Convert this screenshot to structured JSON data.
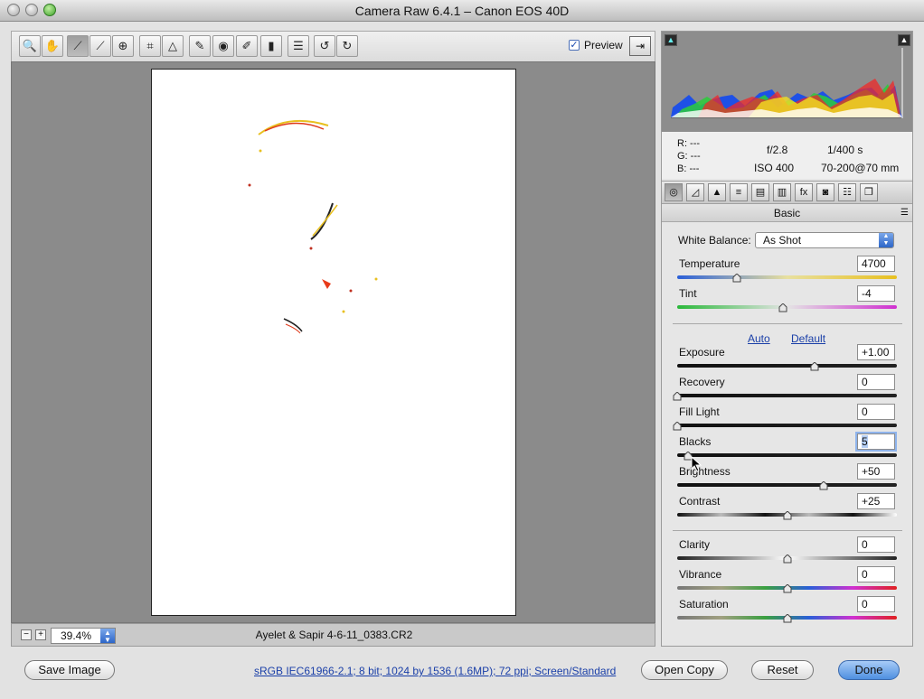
{
  "window": {
    "title": "Camera Raw 6.4.1  –  Canon EOS 40D"
  },
  "toolbar": {
    "tools": [
      {
        "name": "zoom-tool",
        "glyph": "🔍"
      },
      {
        "name": "hand-tool",
        "glyph": "✋"
      },
      {
        "name": "white-balance-tool",
        "glyph": "⟋"
      },
      {
        "name": "color-sampler-tool",
        "glyph": "⟋"
      },
      {
        "name": "targeted-adjustment-tool",
        "glyph": "⊕"
      },
      {
        "name": "crop-tool",
        "glyph": "⌗"
      },
      {
        "name": "straighten-tool",
        "glyph": "△"
      },
      {
        "name": "spot-removal-tool",
        "glyph": "✎"
      },
      {
        "name": "red-eye-tool",
        "glyph": "◉"
      },
      {
        "name": "adjustment-brush-tool",
        "glyph": "✐"
      },
      {
        "name": "graduated-filter-tool",
        "glyph": "▮"
      },
      {
        "name": "preferences-tool",
        "glyph": "☰"
      },
      {
        "name": "rotate-left-tool",
        "glyph": "↺"
      },
      {
        "name": "rotate-right-tool",
        "glyph": "↻"
      }
    ],
    "preview_label": "Preview",
    "preview_checked": true
  },
  "status": {
    "zoom": "39.4%",
    "filename": "Ayelet & Sapir 4-6-11_0383.CR2"
  },
  "info": {
    "r": "R:  ---",
    "g": "G:  ---",
    "b": "B:  ---",
    "aperture": "f/2.8",
    "shutter": "1/400 s",
    "iso": "ISO 400",
    "lens": "70-200@70 mm"
  },
  "panel": {
    "title": "Basic",
    "tabs": [
      {
        "name": "basic",
        "glyph": "◎"
      },
      {
        "name": "tone-curve",
        "glyph": "◿"
      },
      {
        "name": "detail",
        "glyph": "▲"
      },
      {
        "name": "hsl",
        "glyph": "≡"
      },
      {
        "name": "split-toning",
        "glyph": "▤"
      },
      {
        "name": "lens-corrections",
        "glyph": "▥"
      },
      {
        "name": "effects",
        "glyph": "fx"
      },
      {
        "name": "camera-calibration",
        "glyph": "◙"
      },
      {
        "name": "presets",
        "glyph": "☷"
      },
      {
        "name": "snapshots",
        "glyph": "❐"
      }
    ],
    "white_balance": {
      "label": "White Balance:",
      "value": "As Shot"
    },
    "auto": "Auto",
    "default": "Default",
    "sliders": [
      {
        "id": "temperature",
        "label": "Temperature",
        "value": "4700",
        "pos": 0.27
      },
      {
        "id": "tint",
        "label": "Tint",
        "value": "-4",
        "pos": 0.48
      },
      {
        "id": "exposure",
        "label": "Exposure",
        "value": "+1.00",
        "pos": 0.625
      },
      {
        "id": "recovery",
        "label": "Recovery",
        "value": "0",
        "pos": 0.0
      },
      {
        "id": "fill-light",
        "label": "Fill Light",
        "value": "0",
        "pos": 0.0
      },
      {
        "id": "blacks",
        "label": "Blacks",
        "value": "5",
        "pos": 0.05
      },
      {
        "id": "brightness",
        "label": "Brightness",
        "value": "+50",
        "pos": 0.665
      },
      {
        "id": "contrast",
        "label": "Contrast",
        "value": "+25",
        "pos": 0.5
      },
      {
        "id": "clarity",
        "label": "Clarity",
        "value": "0",
        "pos": 0.5
      },
      {
        "id": "vibrance",
        "label": "Vibrance",
        "value": "0",
        "pos": 0.5
      },
      {
        "id": "saturation",
        "label": "Saturation",
        "value": "0",
        "pos": 0.5
      }
    ]
  },
  "footer": {
    "save": "Save Image",
    "workflow": "sRGB IEC61966-2.1; 8 bit; 1024 by 1536 (1.6MP); 72 ppi; Screen/Standard",
    "open": "Open Copy",
    "reset": "Reset",
    "done": "Done"
  }
}
